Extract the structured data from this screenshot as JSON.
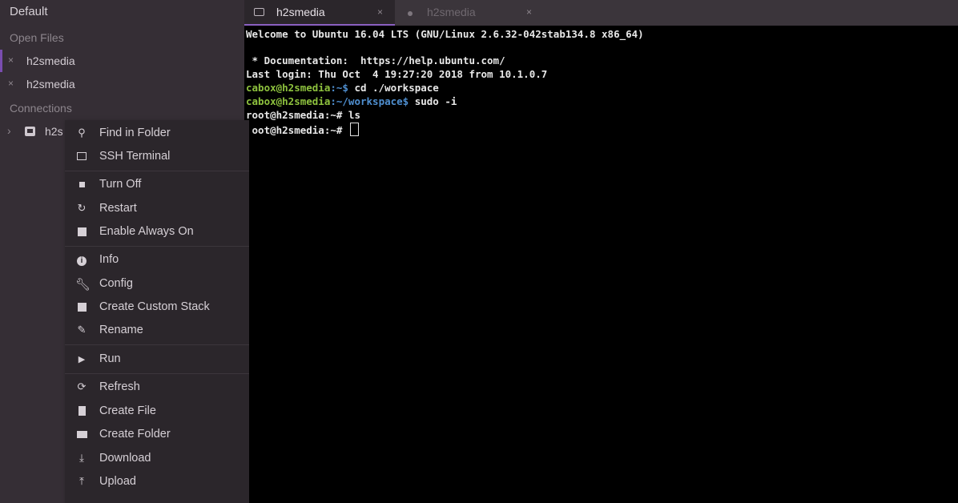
{
  "sidebar": {
    "title": "Default",
    "open_files_label": "Open Files",
    "open_files": [
      {
        "name": "h2smedia",
        "close": "×"
      },
      {
        "name": "h2smedia",
        "close": "×"
      }
    ],
    "connections_label": "Connections",
    "connection": {
      "name": "h2s",
      "chevron": "›"
    }
  },
  "tabs": [
    {
      "label": "h2smedia",
      "close": "×"
    },
    {
      "label": "h2smedia",
      "close": "×"
    }
  ],
  "terminal": {
    "line1": "Welcome to Ubuntu 16.04 LTS (GNU/Linux 2.6.32-042stab134.8 x86_64)",
    "line2": " * Documentation:  https://help.ubuntu.com/",
    "line3": "Last login: Thu Oct  4 19:27:20 2018 from 10.1.0.7",
    "line4_user": "cabox@h2smedia",
    "line4_path": ":~$",
    "line4_cmd": " cd ./workspace",
    "line5_user": "cabox@h2smedia",
    "line5_path": ":~/workspace$",
    "line5_cmd": " sudo -i",
    "line6": "root@h2smedia:~# ls",
    "line7": " oot@h2smedia:~# "
  },
  "context_menu": {
    "items": [
      {
        "label": "Find in Folder",
        "icon": "search-icon",
        "glyph": "🔍"
      },
      {
        "label": "SSH Terminal",
        "icon": "terminal-icon"
      },
      {
        "label": "Turn Off",
        "icon": "stop-icon"
      },
      {
        "label": "Restart",
        "icon": "restart-icon",
        "glyph": "↻"
      },
      {
        "label": "Enable Always On",
        "icon": "always-on-icon"
      },
      {
        "label": "Info",
        "icon": "info-icon",
        "glyph": "i"
      },
      {
        "label": "Config",
        "icon": "wrench-icon",
        "glyph": "🔧"
      },
      {
        "label": "Create Custom Stack",
        "icon": "stack-icon"
      },
      {
        "label": "Rename",
        "icon": "pencil-icon",
        "glyph": "✎"
      },
      {
        "label": "Run",
        "icon": "play-icon",
        "glyph": "▶"
      },
      {
        "label": "Refresh",
        "icon": "refresh-icon",
        "glyph": "⟳"
      },
      {
        "label": "Create File",
        "icon": "file-icon"
      },
      {
        "label": "Create Folder",
        "icon": "folder-icon"
      },
      {
        "label": "Download",
        "icon": "download-icon",
        "glyph": "⤓"
      },
      {
        "label": "Upload",
        "icon": "upload-icon",
        "glyph": "⤒"
      }
    ]
  }
}
